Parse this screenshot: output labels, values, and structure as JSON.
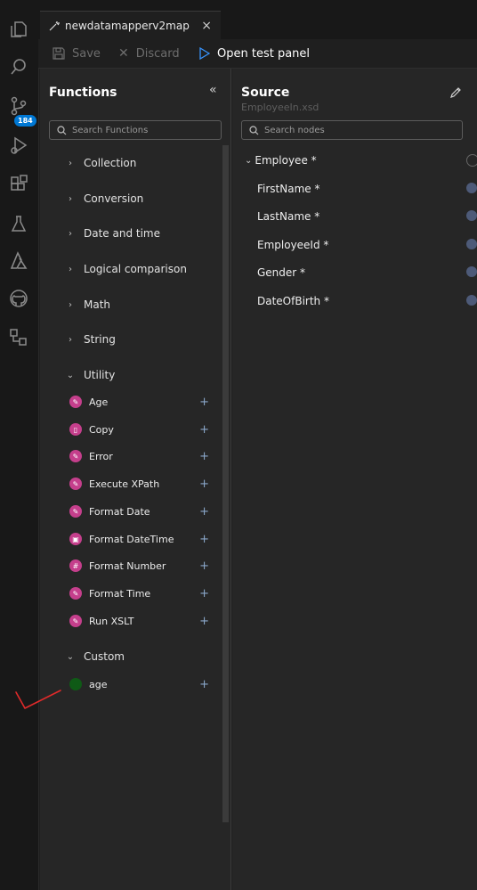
{
  "tab": {
    "title": "newdatamapperv2map",
    "close": "×"
  },
  "activity": {
    "badge": "184"
  },
  "toolbar": {
    "save": "Save",
    "discard": "Discard",
    "open_test": "Open test panel"
  },
  "functions": {
    "title": "Functions",
    "search_placeholder": "Search Functions",
    "categories": [
      {
        "label": "Collection"
      },
      {
        "label": "Conversion"
      },
      {
        "label": "Date and time"
      },
      {
        "label": "Logical comparison"
      },
      {
        "label": "Math"
      },
      {
        "label": "String"
      },
      {
        "label": "Utility"
      }
    ],
    "utility_items": [
      {
        "label": "Age",
        "icon": "✎"
      },
      {
        "label": "Copy",
        "icon": "▯"
      },
      {
        "label": "Error",
        "icon": "✎"
      },
      {
        "label": "Execute XPath",
        "icon": "✎"
      },
      {
        "label": "Format Date",
        "icon": "✎"
      },
      {
        "label": "Format DateTime",
        "icon": "▣"
      },
      {
        "label": "Format Number",
        "icon": "#"
      },
      {
        "label": "Format Time",
        "icon": "✎"
      },
      {
        "label": "Run XSLT",
        "icon": "✎"
      }
    ],
    "custom_label": "Custom",
    "custom_items": [
      {
        "label": "age"
      }
    ],
    "add_symbol": "+"
  },
  "source": {
    "title": "Source",
    "subtitle": "EmployeeIn.xsd",
    "search_placeholder": "Search nodes",
    "root": "Employee *",
    "children": [
      "FirstName *",
      "LastName *",
      "EmployeeId *",
      "Gender *",
      "DateOfBirth *"
    ]
  },
  "colors": {
    "accent": "#0078d4",
    "function_icon": "#c53f8c",
    "custom_icon": "#0f5a16",
    "annotation": "#e02a2a"
  }
}
